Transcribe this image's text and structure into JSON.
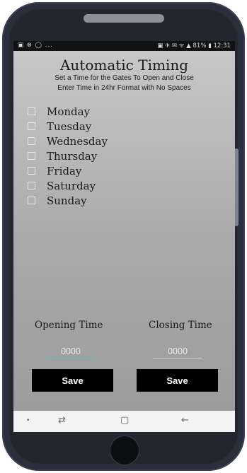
{
  "status_bar": {
    "left_icons": "▣ ⊗ ◯ ...",
    "right_icons": "▣ ✈ ✉ ᯤ ▲",
    "battery": "81%",
    "time": "12:31"
  },
  "header": {
    "title": "Automatic Timing",
    "subtitle_line1": "Set a Time for the Gates To Open and Close",
    "subtitle_line2": "Enter Time in 24hr Format with No Spaces"
  },
  "days": [
    {
      "label": "Monday",
      "checked": false
    },
    {
      "label": "Tuesday",
      "checked": false
    },
    {
      "label": "Wednesday",
      "checked": false
    },
    {
      "label": "Thursday",
      "checked": false
    },
    {
      "label": "Friday",
      "checked": false
    },
    {
      "label": "Saturday",
      "checked": false
    },
    {
      "label": "Sunday",
      "checked": false
    }
  ],
  "opening": {
    "label": "Opening Time",
    "placeholder": "0000",
    "save_label": "Save"
  },
  "closing": {
    "label": "Closing Time",
    "placeholder": "0000",
    "save_label": "Save"
  },
  "nav": {
    "dot": "•",
    "recent": "⇄",
    "home": "▢",
    "back": "←"
  },
  "colors": {
    "accent_underline": "#5fc0c8",
    "button_bg": "#000000",
    "screen_top": "#c9c9c9",
    "screen_bottom": "#9a9a9a"
  }
}
